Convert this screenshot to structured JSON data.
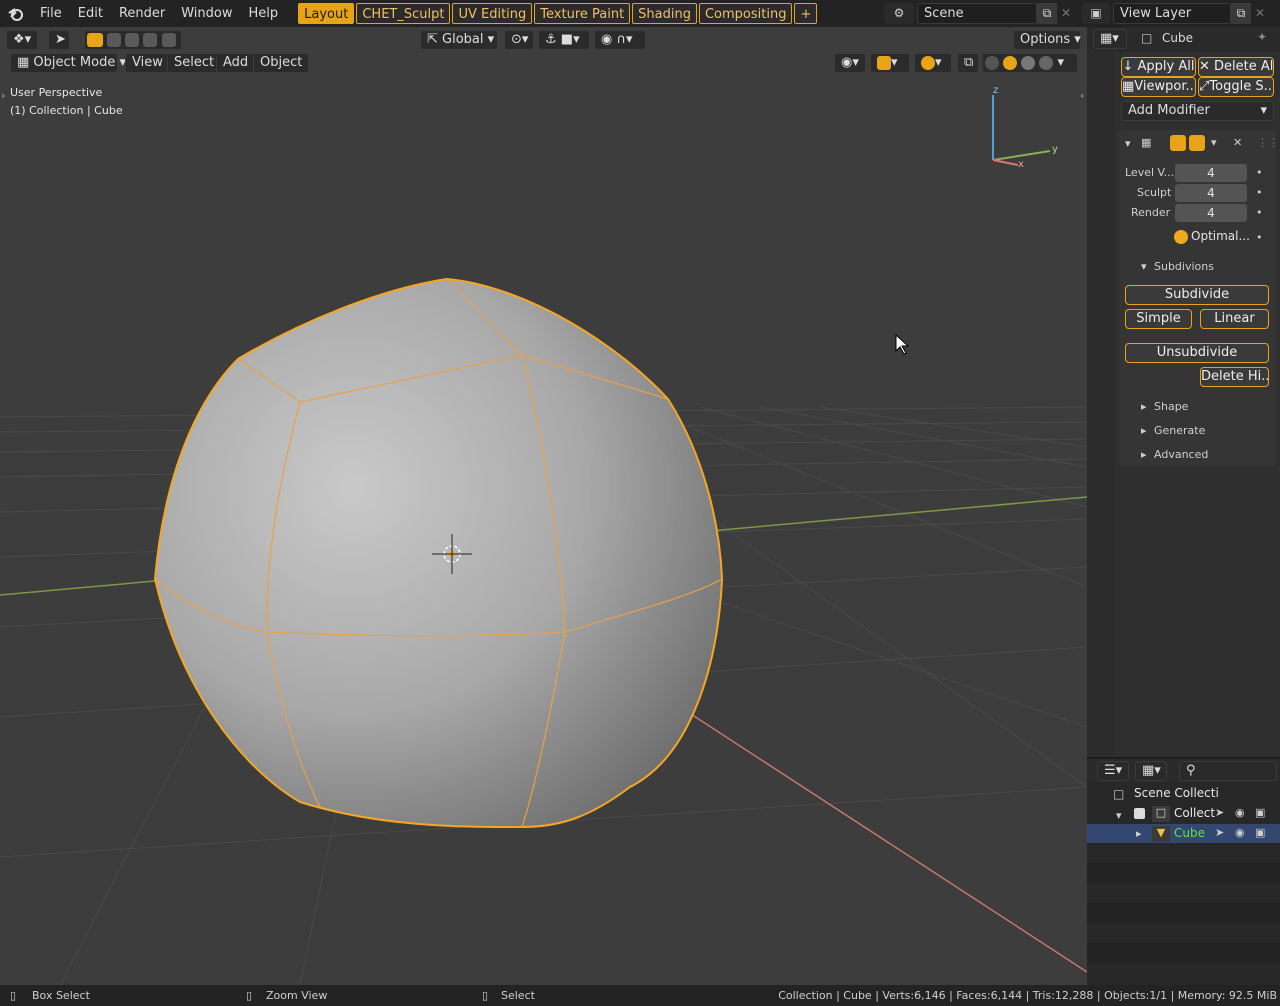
{
  "menu": {
    "file": "File",
    "edit": "Edit",
    "render": "Render",
    "window": "Window",
    "help": "Help"
  },
  "workspaces": [
    "Layout",
    "CHET_Sculpt",
    "UV Editing",
    "Texture Paint",
    "Shading",
    "Compositing",
    "+"
  ],
  "scene": {
    "name": "Scene"
  },
  "view_layer": {
    "name": "View Layer"
  },
  "viewport": {
    "transform_orientation": "Global",
    "options": "Options",
    "mode": "Object Mode",
    "menus": {
      "view": "View",
      "select": "Select",
      "add": "Add",
      "object": "Object"
    },
    "overlay_text": {
      "perspective": "User Perspective",
      "collection": "(1) Collection | Cube"
    },
    "gizmo_axes": {
      "z": "z",
      "y": "y",
      "x": "x"
    }
  },
  "properties": {
    "object_name": "Cube",
    "apply_all": "Apply All",
    "delete_all": "Delete All",
    "viewport": "Viewpor...",
    "toggle": "Toggle S...",
    "add_modifier": "Add Modifier",
    "levels": [
      {
        "label": "Level V...",
        "value": "4"
      },
      {
        "label": "Sculpt",
        "value": "4"
      },
      {
        "label": "Render",
        "value": "4"
      }
    ],
    "optimal": "Optimal...",
    "subdivisions_header": "Subdivions",
    "subdivide": "Subdivide",
    "simple": "Simple",
    "linear": "Linear",
    "unsubdivide": "Unsubdivide",
    "delete_higher": "Delete Hi...",
    "panels": [
      "Shape",
      "Generate",
      "Advanced"
    ]
  },
  "outliner": {
    "scene_collection": "Scene Collecti",
    "collection": "Collect",
    "cube": "Cube"
  },
  "status": {
    "box_select": "Box Select",
    "zoom_view": "Zoom View",
    "select": "Select",
    "info": "Collection | Cube | Verts:6,146 | Faces:6,144 | Tris:12,288 | Objects:1/1 | Memory: 92.5 MiB"
  },
  "colors": {
    "accent": "#e9a317",
    "viewport_bg": "#3d3d3d",
    "selected_outline": "#f5a623",
    "x_axis": "#d9776f",
    "y_axis": "#8ab04f",
    "z_axis": "#4fa0d9"
  }
}
